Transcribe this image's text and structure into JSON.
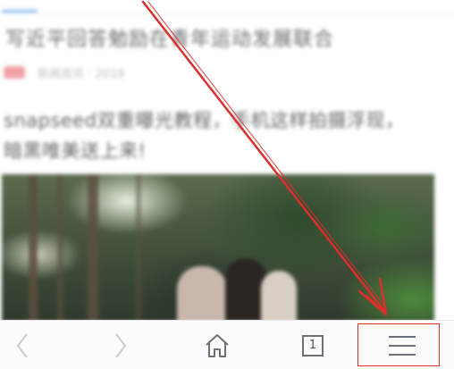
{
  "feed": {
    "headline_1": "写近平回答勉励在青年运动发展联合",
    "meta_1": "新闻资讯 · 2019",
    "headline_2": "snapseed双重曝光教程，手机这样拍摄浮现，暗黑唯美送上来!"
  },
  "toolbar": {
    "back_icon": "chevron-left-icon",
    "forward_icon": "chevron-right-icon",
    "home_icon": "home-icon",
    "tabs_count": "1",
    "menu_icon": "hamburger-menu-icon"
  },
  "annotation": {
    "arrow_color": "#d9302c",
    "highlight_color": "#d9302c"
  },
  "colors": {
    "toolbar_bg": "#fbfbfc",
    "icon_color": "#6b7079",
    "disabled_icon_color": "#c9ccd1",
    "tab_indicator": "#7fb6f2"
  }
}
